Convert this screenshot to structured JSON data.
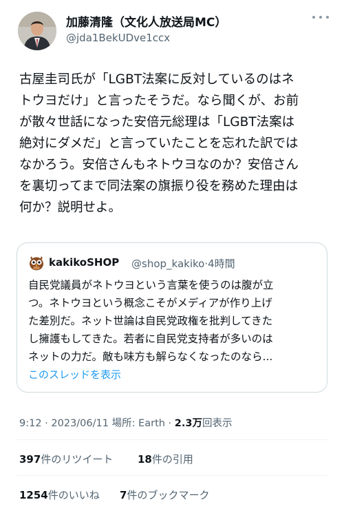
{
  "author": {
    "name": "加藤清隆（文化人放送局MC）",
    "handle": "@jda1BekUDve1ccx"
  },
  "tweet": {
    "lines": [
      "古屋圭司氏が「LGBT法案に反対しているのはネ",
      "トウヨだけ」と言ったそうだ。なら聞くが、お前",
      "が散々世話になった安倍元総理は「LGBT法案は",
      "絶対にダメだ」と言っていたことを忘れた訳では",
      "なかろう。安倍さんもネトウヨなのか？安倍さん",
      "を裏切ってまで同法案の旗振り役を務めた理由は",
      "何か？説明せよ。"
    ]
  },
  "quote": {
    "name": "kakikoSHOP",
    "handle": "@shop_kakiko",
    "time": "·4時間",
    "lines": [
      "自民党議員がネトウヨという言葉を使うのは腹が立",
      "つ。ネトウヨという概念こそがメディアが作り上げ",
      "た差別だ。ネット世論は自民党政権を批判してきた",
      "し擁護もしてきた。若者に自民党支持者が多いのは",
      "ネットの力だ。敵も味方も解らなくなったのなら..."
    ],
    "show_thread": "このスレッドを表示"
  },
  "meta": {
    "time_date": "9:12 · 2023/06/11 場所: Earth · ",
    "views_count": "2.3万",
    "views_label": "回表示"
  },
  "stats": {
    "retweets_count": "397",
    "retweets_label": "件のリツイート",
    "quotes_count": "18",
    "quotes_label": "件の引用",
    "likes_count": "1254",
    "likes_label": "件のいいね",
    "bookmarks_count": "7",
    "bookmarks_label": "件のブックマーク"
  },
  "icons": {
    "more": "more-options-icon",
    "quote_avatar": "owl-icon"
  },
  "colors": {
    "text": "#0f1419",
    "muted": "#536471",
    "link": "#1d9bf0",
    "border": "#cfd9de"
  }
}
